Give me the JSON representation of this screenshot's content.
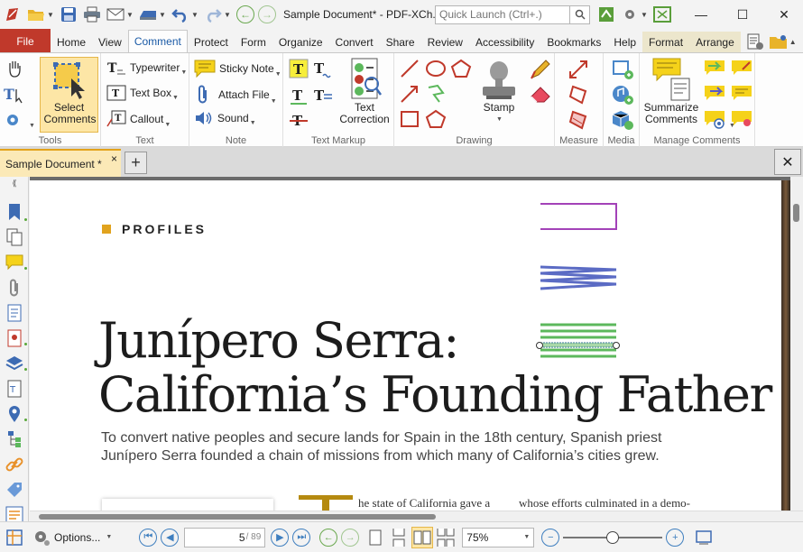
{
  "titlebar": {
    "doc_title": "Sample Document* - PDF-XCh...",
    "quick_launch_placeholder": "Quick Launch (Ctrl+.)"
  },
  "menu": {
    "file": "File",
    "tabs": [
      "Home",
      "View",
      "Comment",
      "Protect",
      "Form",
      "Organize",
      "Convert",
      "Share",
      "Review",
      "Accessibility",
      "Bookmarks",
      "Help",
      "Format",
      "Arrange"
    ],
    "active": "Comment"
  },
  "ribbon": {
    "tools": {
      "label": "Tools",
      "select_comments": "Select Comments"
    },
    "text": {
      "label": "Text",
      "typewriter": "Typewriter",
      "text_box": "Text Box",
      "callout": "Callout"
    },
    "note": {
      "label": "Note",
      "sticky_note": "Sticky Note",
      "attach_file": "Attach File",
      "sound": "Sound"
    },
    "text_markup": {
      "label": "Text Markup",
      "text_correction": "Text Correction"
    },
    "drawing": {
      "label": "Drawing",
      "stamp": "Stamp"
    },
    "measure": {
      "label": "Measure"
    },
    "media": {
      "label": "Media"
    },
    "manage": {
      "label": "Manage Comments",
      "summarize": "Summarize Comments"
    }
  },
  "doctab": {
    "title": "Sample Document *",
    "close": "×"
  },
  "document": {
    "section": "PROFILES",
    "headline_line1": "Junípero Serra:",
    "headline_line2": "California’s Founding Father",
    "subhead": "To convert native peoples and secure lands for Spain in the 18th century, Spanish priest Junípero Serra founded a chain of missions from which many of California’s cities grew.",
    "col1_start": "he state of California gave a",
    "col2_start": "whose efforts culminated in a demo-"
  },
  "status": {
    "options": "Options...",
    "page_current": "5",
    "page_total": "/ 89",
    "zoom": "75%",
    "zoom_fraction": 0.5
  },
  "colors": {
    "accent": "#1a5aa6",
    "file_tab": "#c0392b",
    "doc_tab": "#fbe9b7",
    "headline_square": "#e1a31e",
    "annot_purple": "#a342b8",
    "annot_blue": "#5b6bc4",
    "annot_green": "#5cb85c"
  }
}
